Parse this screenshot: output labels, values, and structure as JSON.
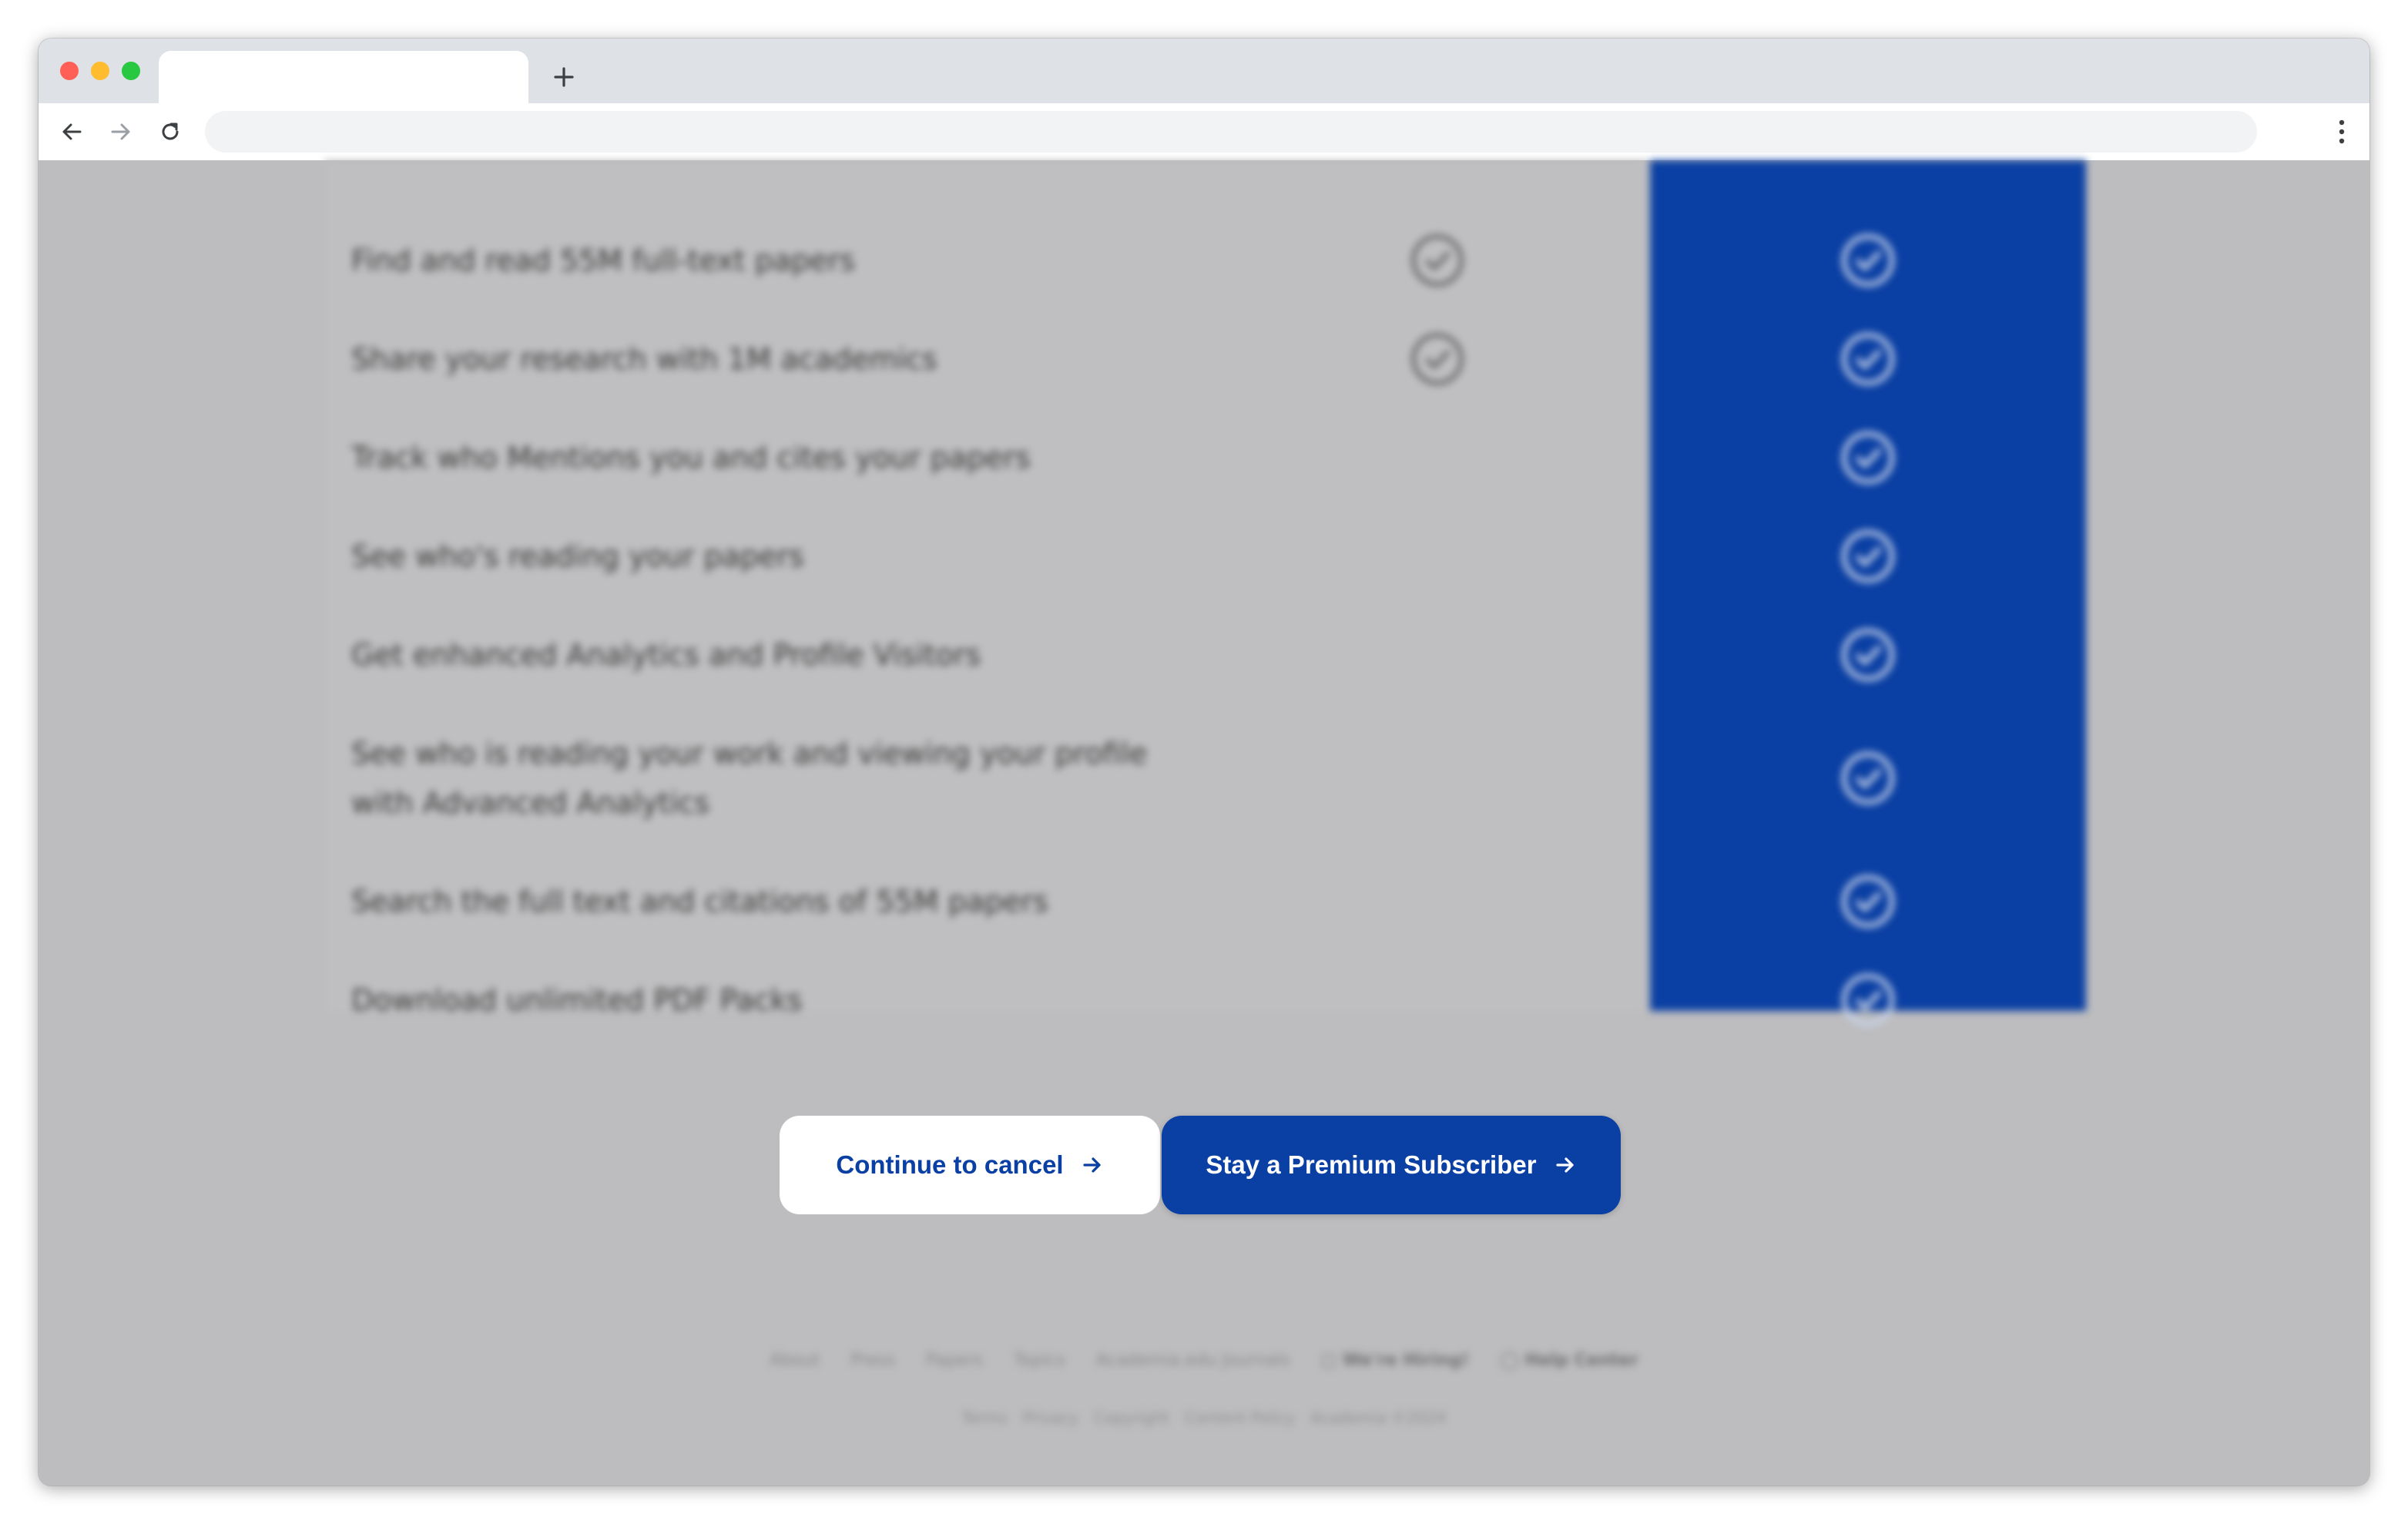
{
  "browser": {
    "tab_title": "",
    "address": "",
    "icons": {
      "close": "close-dot",
      "minimize": "minimize-dot",
      "maximize": "maximize-dot",
      "new_tab": "plus-icon",
      "back": "back-arrow-icon",
      "forward": "forward-arrow-icon",
      "reload": "reload-icon",
      "menu": "kebab-menu-icon"
    },
    "colors": {
      "close": "#ff5f57",
      "minimize": "#febc2e",
      "maximize": "#28c840"
    }
  },
  "features": [
    {
      "label": "Find and read 55M full-text papers",
      "free": true,
      "premium": true
    },
    {
      "label": "Share your research with 1M academics",
      "free": true,
      "premium": true
    },
    {
      "label": "Track who Mentions you and cites your papers",
      "free": false,
      "premium": true
    },
    {
      "label": "See who's reading your papers",
      "free": false,
      "premium": true
    },
    {
      "label": "Get enhanced Analytics and Profile Visitors",
      "free": false,
      "premium": true
    },
    {
      "label": "See who is reading your work and viewing your profile with Advanced Analytics",
      "free": false,
      "premium": true
    },
    {
      "label": "Search the full text and citations of 55M papers",
      "free": false,
      "premium": true
    },
    {
      "label": "Download unlimited PDF Packs",
      "free": false,
      "premium": true
    }
  ],
  "actions": {
    "cancel_label": "Continue to cancel",
    "stay_label": "Stay a Premium Subscriber"
  },
  "footer": {
    "links": [
      "About",
      "Press",
      "Papers",
      "Topics",
      "Academia.edu Journals",
      "We're Hiring!",
      "Help Center"
    ],
    "legal": [
      "Terms",
      "Privacy",
      "Copyright",
      "Content Policy",
      "Academia ©2024"
    ]
  },
  "colors": {
    "brand_blue": "#0a3fa3",
    "overlay_gray": "#bdbdbf"
  }
}
